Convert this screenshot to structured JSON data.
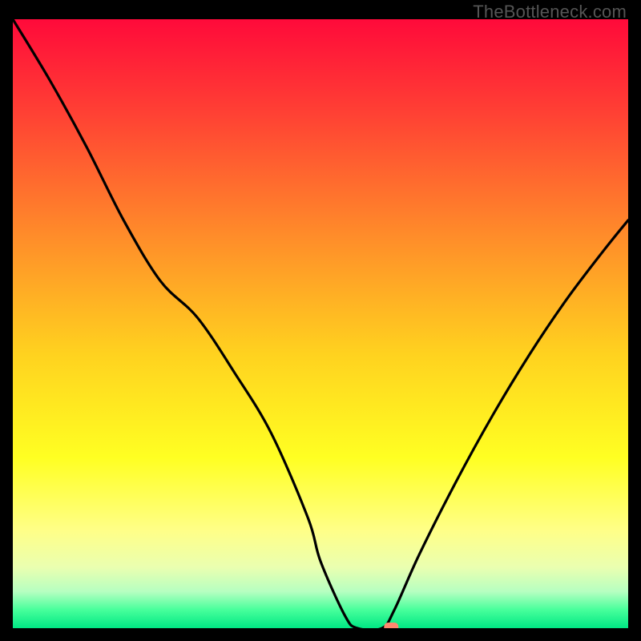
{
  "watermark": "TheBottleneck.com",
  "chart_data": {
    "type": "line",
    "title": "",
    "xlabel": "",
    "ylabel": "",
    "xlim": [
      0,
      100
    ],
    "ylim": [
      0,
      100
    ],
    "x": [
      0,
      6,
      12,
      18,
      24,
      30,
      36,
      42,
      48,
      50,
      54,
      56,
      60,
      62,
      66,
      72,
      78,
      84,
      90,
      96,
      100
    ],
    "values": [
      100,
      90,
      79,
      67,
      57,
      51,
      42,
      32,
      18,
      11,
      2,
      0,
      0,
      3,
      12,
      24,
      35,
      45,
      54,
      62,
      67
    ],
    "grid": false,
    "background_gradient_stops": [
      {
        "offset": 0.0,
        "color": "#ff0a3a"
      },
      {
        "offset": 0.15,
        "color": "#ff3f34"
      },
      {
        "offset": 0.35,
        "color": "#ff8a2a"
      },
      {
        "offset": 0.55,
        "color": "#ffd21f"
      },
      {
        "offset": 0.72,
        "color": "#ffff22"
      },
      {
        "offset": 0.84,
        "color": "#ffff88"
      },
      {
        "offset": 0.9,
        "color": "#eaffb0"
      },
      {
        "offset": 0.94,
        "color": "#b6ffc1"
      },
      {
        "offset": 0.97,
        "color": "#47ff9b"
      },
      {
        "offset": 1.0,
        "color": "#00e884"
      }
    ],
    "marker": {
      "x": 61.5,
      "y": 0,
      "color": "#ff886f"
    }
  }
}
